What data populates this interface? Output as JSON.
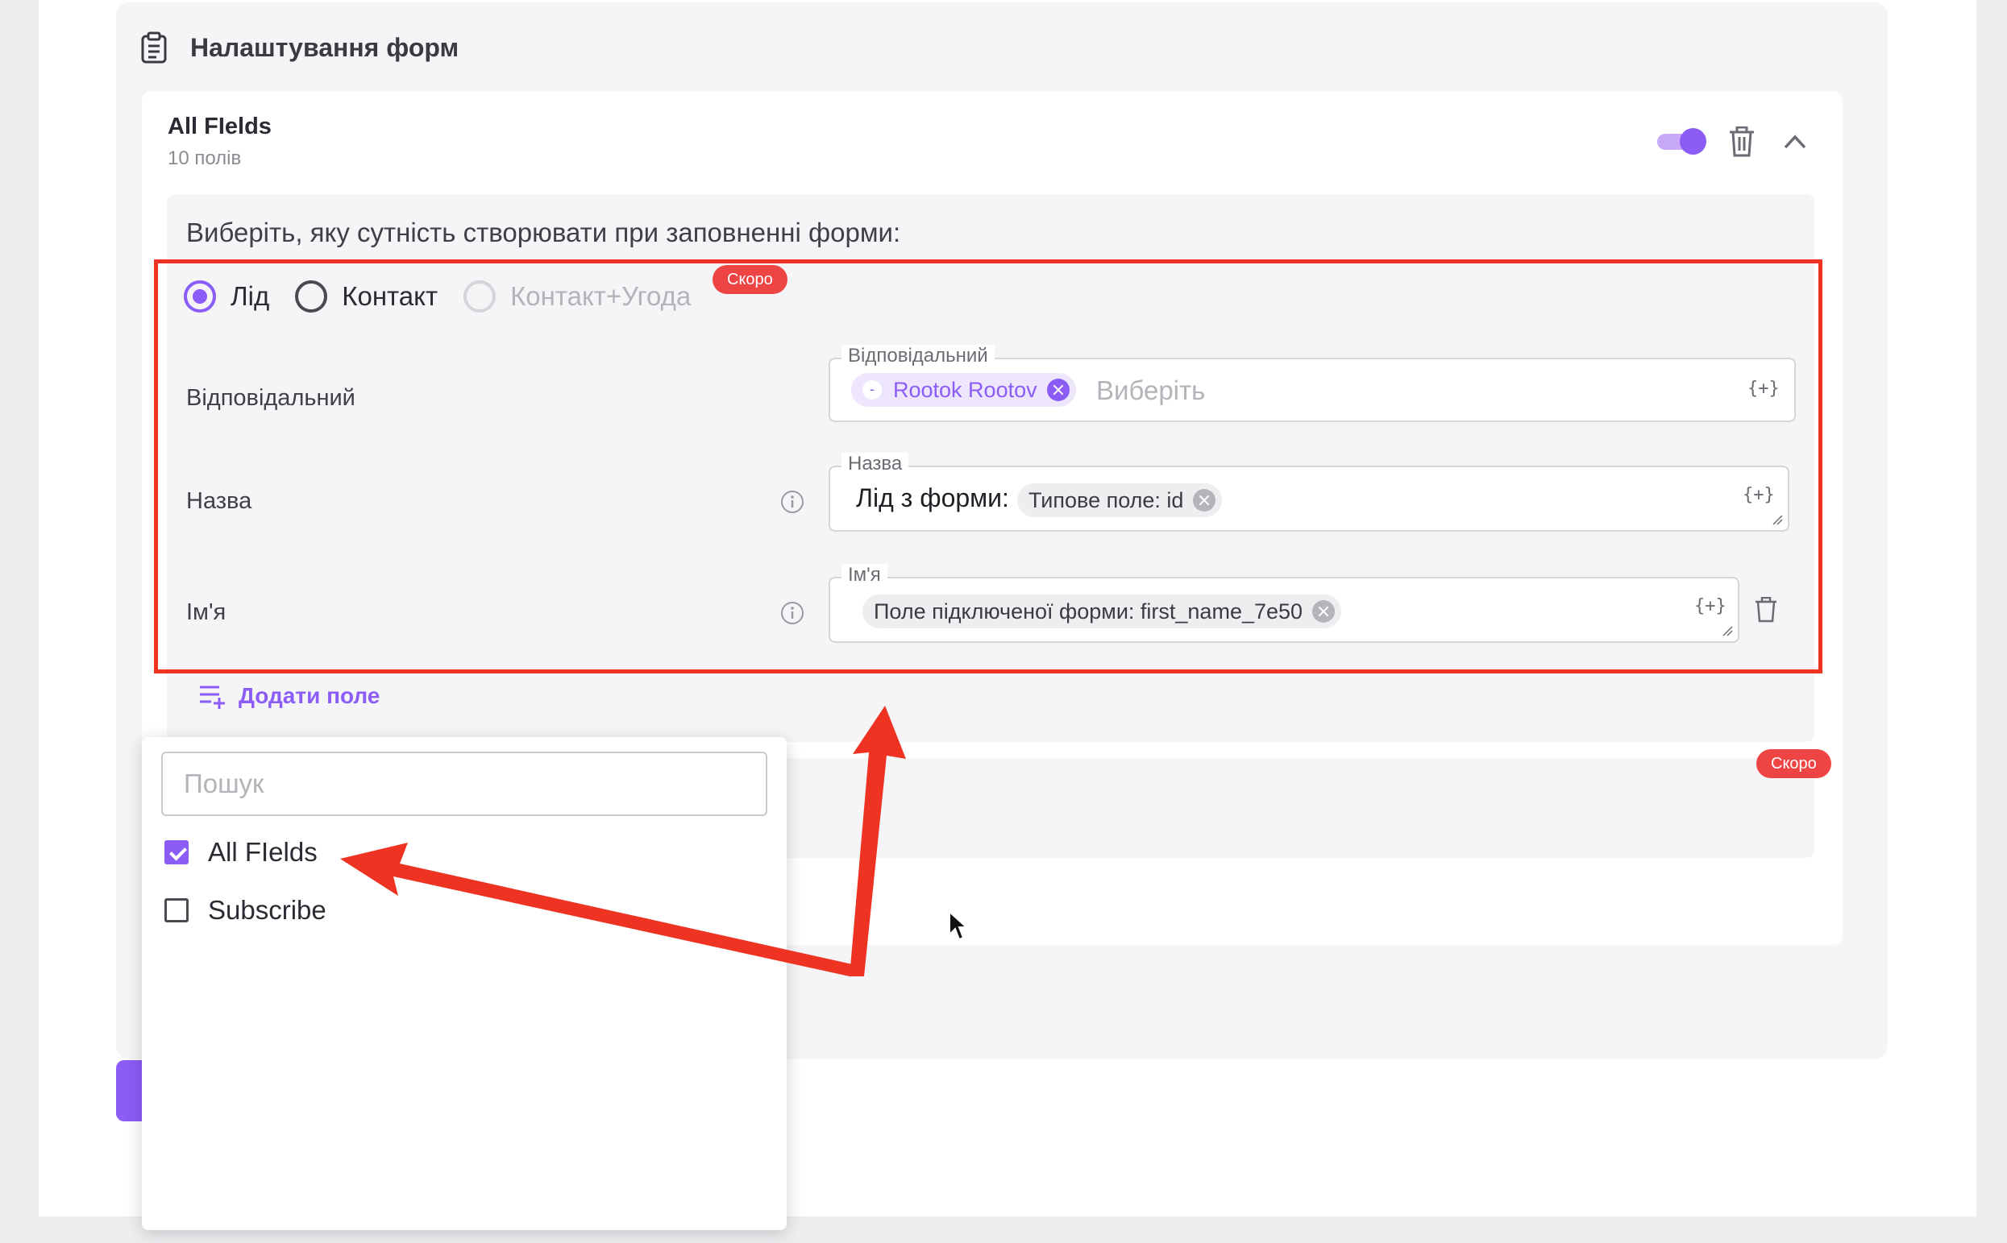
{
  "section": {
    "title": "Налаштування форм",
    "icon": "clipboard-icon"
  },
  "card": {
    "title": "All FIelds",
    "subtitle": "10 полів",
    "toggle_on": true,
    "question": "Виберіть, яку сутність створювати при заповненні форми:"
  },
  "entity_options": [
    {
      "label": "Лід",
      "checked": true,
      "disabled": false
    },
    {
      "label": "Контакт",
      "checked": false,
      "disabled": false
    },
    {
      "label": "Контакт+Угода",
      "checked": false,
      "disabled": true
    }
  ],
  "badges": {
    "soon": "Скоро"
  },
  "rows": {
    "responsible": {
      "label": "Відповідальний",
      "legend": "Відповідальний",
      "chip_avatar": "-",
      "chip": "Rootok Rootov",
      "placeholder": "Виберіть",
      "var_button": "{+}"
    },
    "name": {
      "label": "Назва",
      "legend": "Назва",
      "text": "Лід з форми:",
      "chip": "Типове поле: id",
      "var_button": "{+}"
    },
    "first_name": {
      "label": "Ім'я",
      "legend": "Ім'я",
      "chip": "Поле підключеної форми: first_name_7e50",
      "var_button": "{+}"
    }
  },
  "add_field_label": "Додати поле",
  "dropdown": {
    "search_placeholder": "Пошук",
    "options": [
      {
        "label": "All FIelds",
        "checked": true
      },
      {
        "label": "Subscribe",
        "checked": false
      }
    ]
  },
  "colors": {
    "accent": "#8b5cf6",
    "annotation": "#ef3322",
    "badge": "#ef4444"
  }
}
